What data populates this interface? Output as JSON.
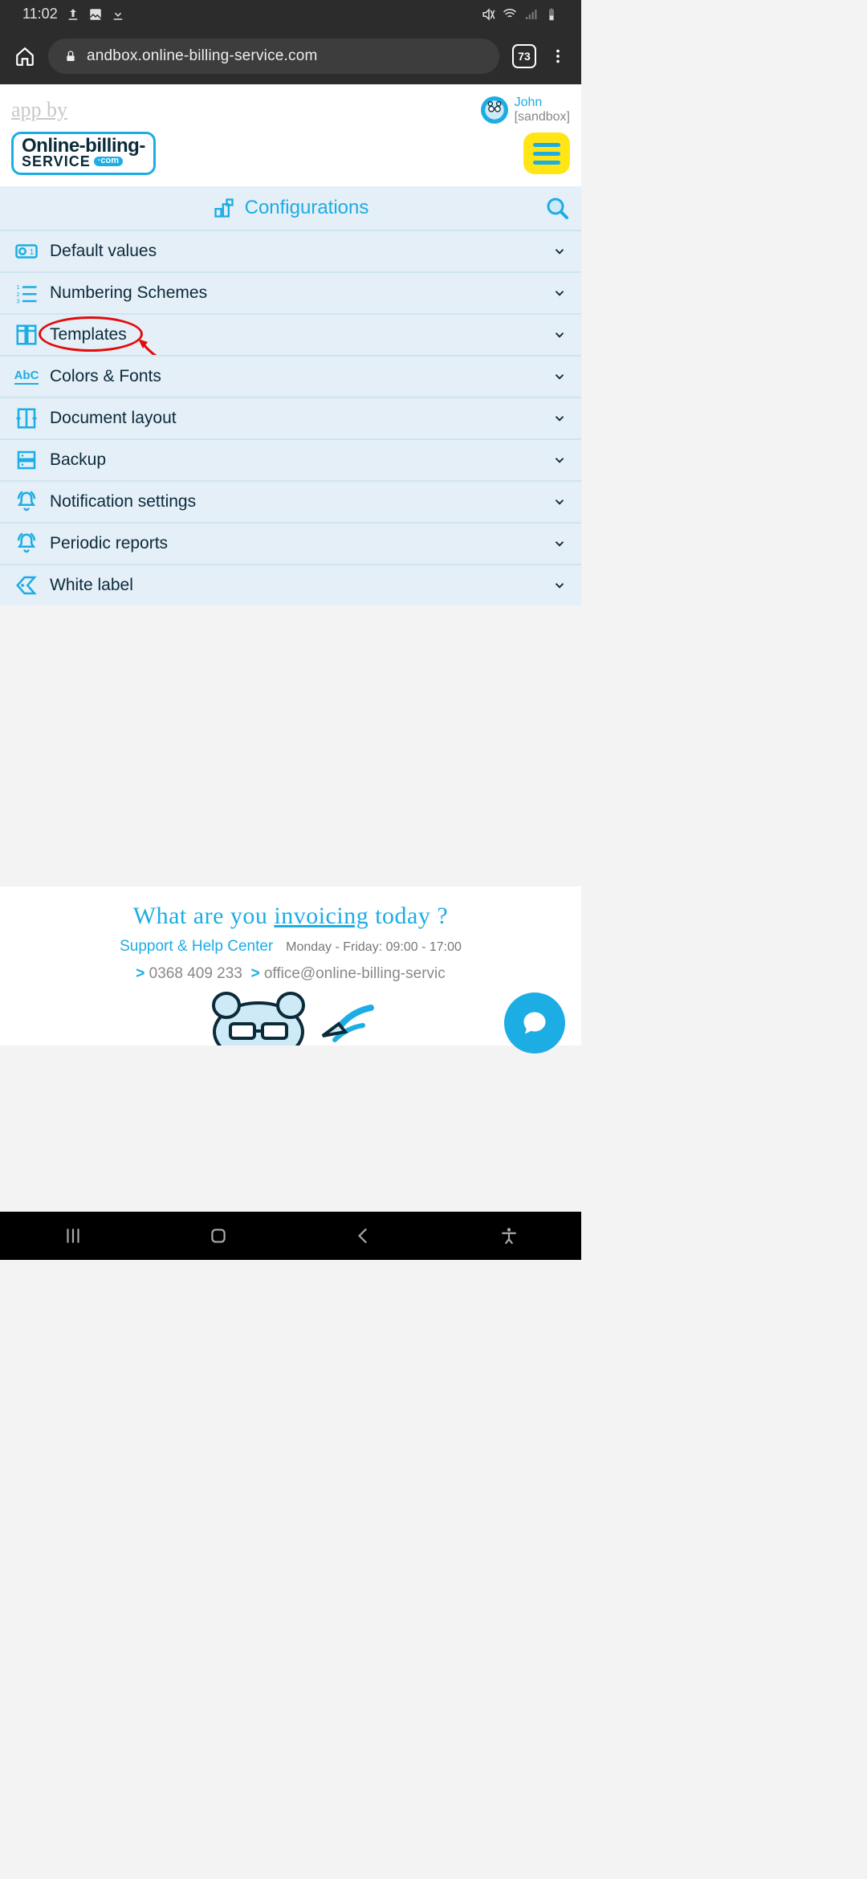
{
  "status": {
    "time": "11:02"
  },
  "browser": {
    "url": "andbox.online-billing-service.com",
    "tab_count": "73"
  },
  "header": {
    "appby": "app by",
    "user_name": "John",
    "user_env": "[sandbox]",
    "logo_line1": "Online-billing-",
    "logo_line2": "SERVICE",
    "logo_dotcom": "·com"
  },
  "panel": {
    "title": "Configurations",
    "items": [
      {
        "label": "Default values"
      },
      {
        "label": "Numbering Schemes"
      },
      {
        "label": "Templates",
        "highlighted": true
      },
      {
        "label": "Colors & Fonts"
      },
      {
        "label": "Document layout"
      },
      {
        "label": "Backup"
      },
      {
        "label": "Notification settings"
      },
      {
        "label": "Periodic reports"
      },
      {
        "label": "White label"
      }
    ]
  },
  "footer": {
    "tagline_pre": "What are you ",
    "tagline_mid": "invoicing",
    "tagline_post": " today ?",
    "support_label": "Support & Help Center",
    "hours": "Monday - Friday: 09:00 - 17:00",
    "phone": "0368 409 233",
    "email": "office@online-billing-servic"
  }
}
